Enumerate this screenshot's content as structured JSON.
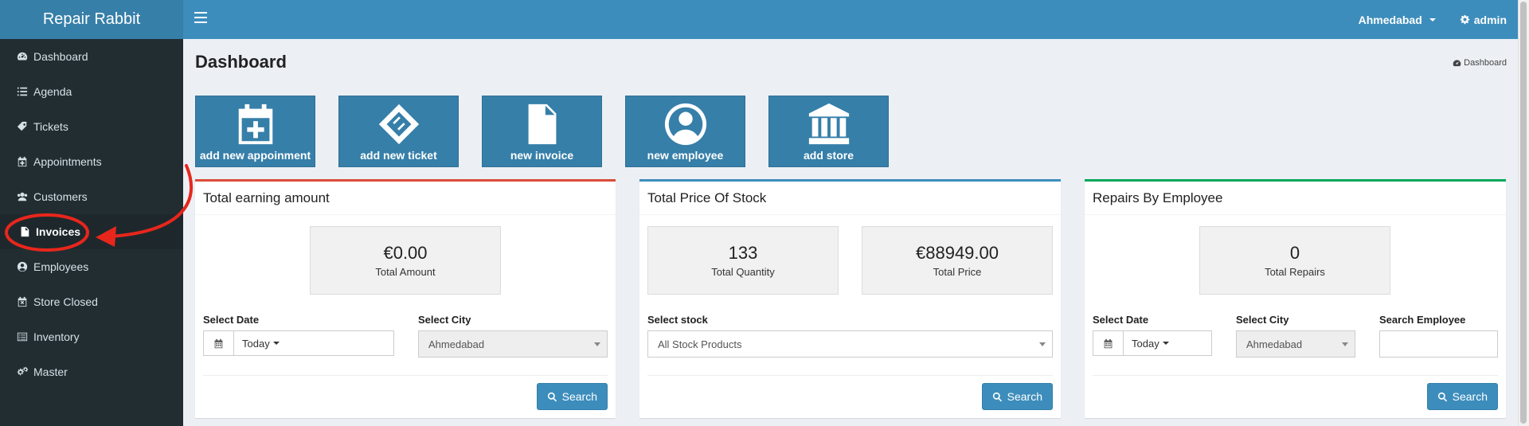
{
  "app": {
    "title": "Repair Rabbit"
  },
  "sidebar": {
    "items": [
      {
        "label": "Dashboard",
        "icon": "dashboard-icon"
      },
      {
        "label": "Agenda",
        "icon": "list-icon"
      },
      {
        "label": "Tickets",
        "icon": "tag-icon"
      },
      {
        "label": "Appointments",
        "icon": "calendar-icon"
      },
      {
        "label": "Customers",
        "icon": "users-icon"
      },
      {
        "label": "Invoices",
        "icon": "file-icon",
        "active": true
      },
      {
        "label": "Employees",
        "icon": "user-circle-icon"
      },
      {
        "label": "Store Closed",
        "icon": "calendar-x-icon"
      },
      {
        "label": "Inventory",
        "icon": "list-alt-icon"
      },
      {
        "label": "Master",
        "icon": "cogs-icon"
      }
    ]
  },
  "navbar": {
    "city": "Ahmedabad",
    "user": "admin"
  },
  "page": {
    "title": "Dashboard",
    "breadcrumb": "Dashboard"
  },
  "quick_actions": [
    {
      "label": "add new appoinment",
      "icon": "calendar-plus-icon"
    },
    {
      "label": "add new ticket",
      "icon": "ticket-icon"
    },
    {
      "label": "new invoice",
      "icon": "document-icon"
    },
    {
      "label": "new employee",
      "icon": "user-icon"
    },
    {
      "label": "add store",
      "icon": "bank-icon"
    }
  ],
  "earning_box": {
    "title": "Total earning amount",
    "stat_value": "€0.00",
    "stat_label": "Total Amount",
    "date_label": "Select Date",
    "date_value": "Today",
    "city_label": "Select City",
    "city_value": "Ahmedabad",
    "search_label": "Search"
  },
  "stock_box": {
    "title": "Total Price Of Stock",
    "qty_value": "133",
    "qty_label": "Total Quantity",
    "price_value": "€88949.00",
    "price_label": "Total Price",
    "stock_label": "Select stock",
    "stock_value": "All Stock Products",
    "search_label": "Search"
  },
  "repairs_box": {
    "title": "Repairs By Employee",
    "stat_value": "0",
    "stat_label": "Total Repairs",
    "date_label": "Select Date",
    "date_value": "Today",
    "city_label": "Select City",
    "city_value": "Ahmedabad",
    "employee_label": "Search Employee",
    "employee_value": "",
    "search_label": "Search"
  },
  "colors": {
    "header": "#3c8dbc",
    "sidebar": "#222d32",
    "annotation": "#e8261c",
    "earning_border": "#dd4b39",
    "stock_border": "#3c8dbc",
    "repairs_border": "#00a65a"
  }
}
